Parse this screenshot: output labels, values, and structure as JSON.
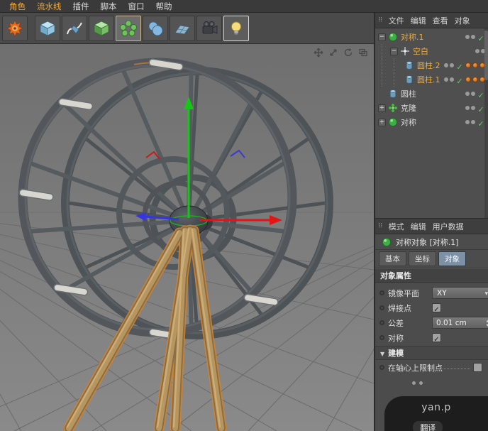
{
  "menubar": {
    "items": [
      {
        "label": "角色",
        "style": "color:#efa93a"
      },
      {
        "label": "流水线",
        "style": "color:#efa93a"
      },
      {
        "label": "插件",
        "style": "color:#dcdcdc"
      },
      {
        "label": "脚本",
        "style": "color:#dcdcdc"
      },
      {
        "label": "窗口",
        "style": "color:#dcdcdc"
      },
      {
        "label": "帮助",
        "style": "color:#dcdcdc"
      }
    ]
  },
  "toolbar": {
    "icons": [
      "gear-tool-icon",
      "cube-primitive-icon",
      "spline-pen-icon",
      "subdivision-surface-icon",
      "array-generator-icon",
      "metaball-icon",
      "floor-icon",
      "camera-icon",
      "light-icon"
    ]
  },
  "viewport": {
    "nav_icons": [
      "pan-view-icon",
      "dolly-view-icon",
      "rotate-view-icon",
      "toggle-view-icon"
    ],
    "scene_elements": [
      "ground-grid",
      "ferris-wheel-model",
      "support-legs",
      "axis-gizmo"
    ],
    "colors": {
      "background_top": "#6f6f6f",
      "background_bottom": "#8a8a8a",
      "grid": "#6b6b6b",
      "tube": "#53575b",
      "white_segment": "#d8d7cf",
      "leg": "#b6955f",
      "selection": "#d4832c",
      "axis_x": "#e21515",
      "axis_y": "#17c517",
      "axis_z": "#3535e2"
    }
  },
  "object_manager": {
    "menu": [
      "文件",
      "编辑",
      "查看",
      "对象"
    ],
    "tree": [
      {
        "label": "对称.1",
        "style": "color:#e9aa3f"
      },
      {
        "label": "空白",
        "style": "color:#e9aa3f"
      },
      {
        "label": "圆柱.2",
        "style": "color:#e9aa3f"
      },
      {
        "label": "圆柱.1",
        "style": "color:#e9aa3f"
      },
      {
        "label": "圆柱",
        "style": "color:#dadada"
      },
      {
        "label": "克隆",
        "style": "color:#dadada"
      },
      {
        "label": "对称",
        "style": "color:#dadada"
      }
    ]
  },
  "attribute_manager": {
    "menu": [
      "模式",
      "编辑",
      "用户数据"
    ],
    "object_title": "对称对象 [对称.1]",
    "tabs": [
      "基本",
      "坐标",
      "对象"
    ],
    "active_tab": "对象",
    "section_title": "对象属性",
    "properties": {
      "mirror_plane_label": "镜像平面",
      "mirror_plane_value": "XY",
      "weld_points_label": "焊接点",
      "weld_points_checked": true,
      "tolerance_label": "公差",
      "tolerance_value": "0.01 cm",
      "symmetry_label": "对称",
      "symmetry_checked": true
    },
    "modeling_section_label": "建模",
    "restrict_axis_label": "在轴心上限制点",
    "restrict_axis_checked": false
  },
  "watermark": {
    "line1": "yan.p",
    "line2": "翻译"
  }
}
